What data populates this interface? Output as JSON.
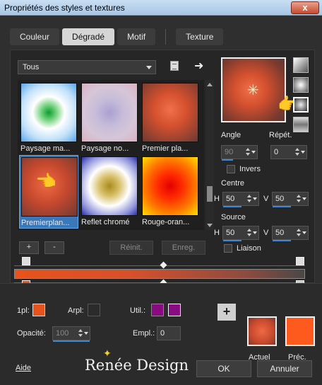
{
  "window": {
    "title": "Propriétés des styles et textures",
    "close_label": "x"
  },
  "tabs": [
    {
      "label": "Couleur",
      "active": false
    },
    {
      "label": "Dégradé",
      "active": true
    },
    {
      "label": "Motif",
      "active": false
    },
    {
      "label": "Texture",
      "active": false
    }
  ],
  "category": {
    "selected": "Tous"
  },
  "gallery": [
    {
      "label": "Paysage ma...",
      "colors": [
        "#0c9c34",
        "#ffffff",
        "#5aa6e8"
      ]
    },
    {
      "label": "Paysage no...",
      "colors": [
        "#a9a0d3",
        "#d6c6d8",
        "#d9b2c2"
      ]
    },
    {
      "label": "Premier pla...",
      "colors": [
        "#f2704a",
        "#c84a2e",
        "#6a3a33"
      ]
    },
    {
      "label": "Premierplan...",
      "colors": [
        "#ef6a44",
        "#c7492e",
        "#6e3a33"
      ],
      "selected": true
    },
    {
      "label": "Reflet chromé",
      "colors": [
        "#a88a1c",
        "#ffffff",
        "#2a2ea6"
      ]
    },
    {
      "label": "Rouge-oran...",
      "colors": [
        "#e50000",
        "#ff5a00",
        "#ffe000"
      ]
    }
  ],
  "buttons": {
    "add": "+",
    "remove": "-",
    "reinit": "Réinit.",
    "save": "Enreg.",
    "ok": "OK",
    "cancel": "Annuler",
    "help": "Aide",
    "add_color": "+"
  },
  "settings": {
    "angle_label": "Angle",
    "angle_value": "90",
    "repeat_label": "Répét.",
    "repeat_value": "0",
    "invert_label": "Invers",
    "invert_checked": false,
    "center_label": "Centre",
    "center_h": "50",
    "center_v": "50",
    "source_label": "Source",
    "source_h": "50",
    "source_v": "50",
    "link_label": "Liaison",
    "link_checked": false,
    "h_label": "H",
    "v_label": "V"
  },
  "ramp": {
    "start_color": "#e8521c",
    "end_color": "#4a4747"
  },
  "bottom": {
    "fg_label": "1pl:",
    "fg_color": "#e8521c",
    "bg_label": "Arpl:",
    "bg_color": "#2b2b2b",
    "util_label": "Util.:",
    "util_color_a": "#8a0a82",
    "util_color_b": "#8a0a82",
    "opacity_label": "Opacité:",
    "opacity_value": "100",
    "location_label": "Empl.:",
    "location_value": "0",
    "current_label": "Actuel",
    "previous_label": "Préc.",
    "current_color": "#d54a28",
    "previous_color": "#ff5a1e"
  },
  "brand": {
    "text": "Renée Design"
  }
}
